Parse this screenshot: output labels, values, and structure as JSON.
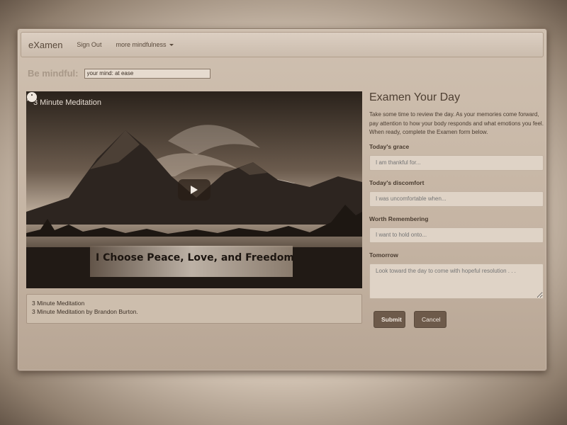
{
  "nav": {
    "brand": "eXamen",
    "sign_out": "Sign Out",
    "more": "more mindfulness"
  },
  "mindful": {
    "label": "Be mindful:",
    "value": "your mind: at ease"
  },
  "video": {
    "title": "3 Minute Meditation",
    "overlay_text": "I Choose Peace, Love, and Freedom",
    "icons": [
      "clock-icon",
      "share-icon",
      "play-icon"
    ]
  },
  "caption": {
    "line1": "3 Minute Meditation",
    "line2": "3 Minute Meditation by Brandon Burton."
  },
  "form": {
    "title": "Examen Your Day",
    "description": "Take some time to review the day. As your memories come forward, pay attention to how your body responds and what emotions you feel. When ready, complete the Examen form below.",
    "grace_label": "Today's grace",
    "grace_placeholder": "I am thankful for...",
    "discomfort_label": "Today's discomfort",
    "discomfort_placeholder": "I was uncomfortable when...",
    "remember_label": "Worth Remembering",
    "remember_placeholder": "I want to hold onto...",
    "tomorrow_label": "Tomorrow",
    "tomorrow_placeholder": "Look toward the day to come with hopeful resolution . . .",
    "submit": "Submit",
    "cancel": "Cancel"
  }
}
